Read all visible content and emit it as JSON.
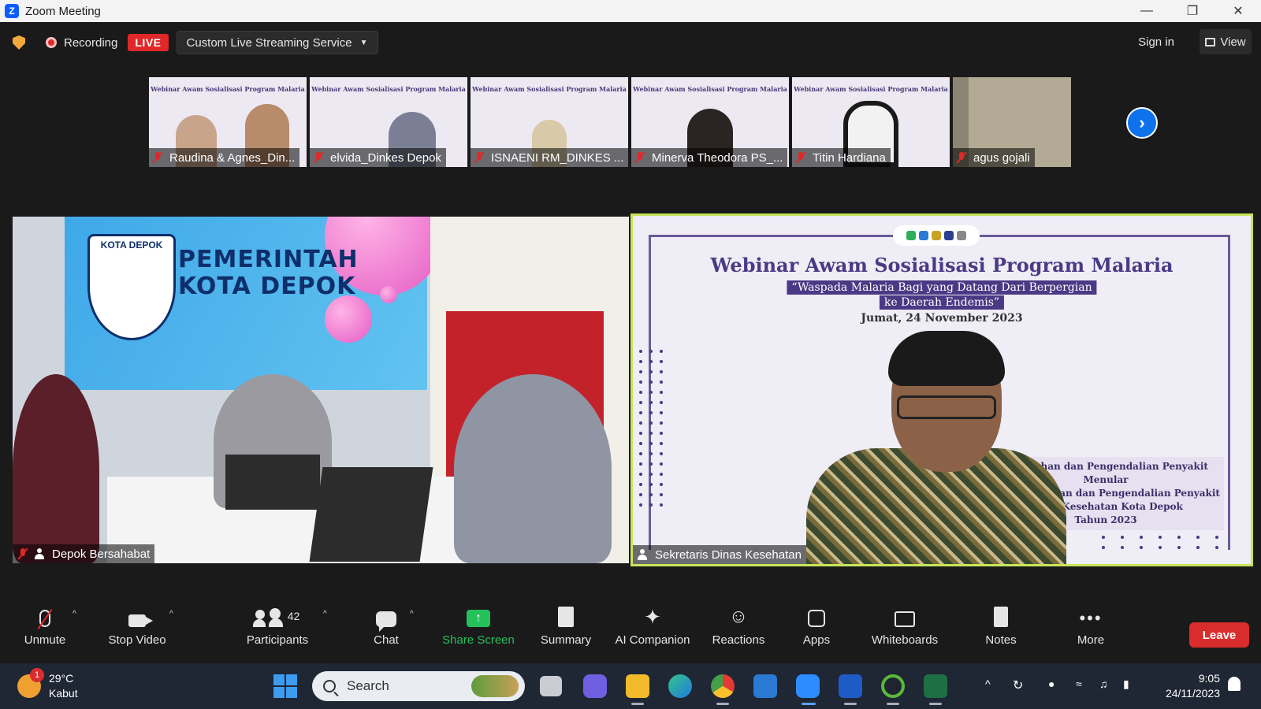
{
  "window": {
    "title": "Zoom Meeting"
  },
  "topbar": {
    "recording_label": "Recording",
    "live_badge": "LIVE",
    "stream_service": "Custom Live Streaming Service",
    "sign_in": "Sign in",
    "view_label": "View"
  },
  "thumbnails": [
    {
      "name": "Raudina & Agnes_Din...",
      "muted": true
    },
    {
      "name": "elvida_Dinkes Depok",
      "muted": true
    },
    {
      "name": "ISNAENI RM_DINKES ...",
      "muted": true
    },
    {
      "name": "Minerva Theodora PS_...",
      "muted": true
    },
    {
      "name": "Titin Hardiana",
      "muted": true
    },
    {
      "name": "agus gojali",
      "muted": true
    }
  ],
  "thumb_slide_title": "Webinar Awam Sosialisasi Program Malaria",
  "main_left": {
    "name": "Depok Bersahabat",
    "banner_badge": "KOTA DEPOK",
    "banner_line1": "PEMERINTAH",
    "banner_line2": "KOTA DEPOK"
  },
  "main_right": {
    "name": "Sekretaris Dinas Kesehatan",
    "slide_title": "Webinar Awam Sosialisasi Program Malaria",
    "slide_sub1": "“Waspada Malaria Bagi yang Datang Dari Berpergian",
    "slide_sub2": "ke Daerah Endemis”",
    "slide_date": "Jumat, 24 November 2023",
    "slide_footer": [
      "encegahan dan Pengendalian Penyakit Menular",
      "ng Pencegahan dan Pengendalian Penyakit",
      "Dinas Kesehatan Kota Depok",
      "Tahun 2023"
    ]
  },
  "toolbar": {
    "unmute": "Unmute",
    "stop_video": "Stop Video",
    "participants": "Participants",
    "participants_count": "42",
    "chat": "Chat",
    "share_screen": "Share Screen",
    "summary": "Summary",
    "ai_companion": "AI Companion",
    "reactions": "Reactions",
    "apps": "Apps",
    "whiteboards": "Whiteboards",
    "notes": "Notes",
    "more": "More",
    "leave": "Leave"
  },
  "taskbar": {
    "weather_badge": "1",
    "temperature": "29°C",
    "weather_desc": "Kabut",
    "search_placeholder": "Search",
    "time": "9:05",
    "date": "24/11/2023"
  },
  "colors": {
    "accent_blue": "#0e72ed",
    "live_red": "#e02828",
    "share_green": "#24c15b",
    "active_speaker": "#c7e55a",
    "leave_red": "#d92d2d"
  }
}
